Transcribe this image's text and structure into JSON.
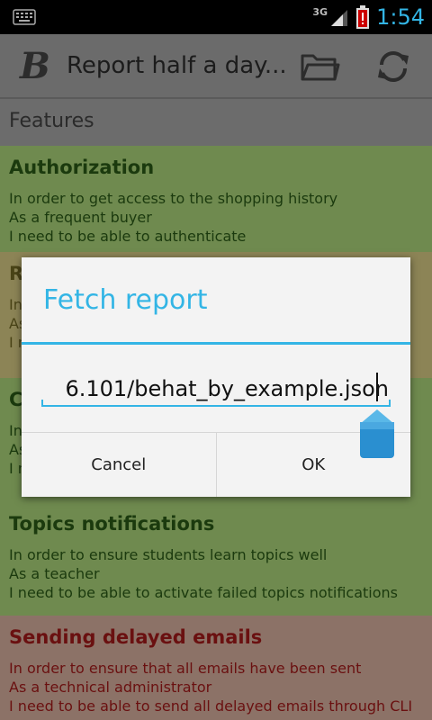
{
  "status_bar": {
    "network": "3G",
    "time": "1:54",
    "icons": [
      "keyboard-icon",
      "signal-icon",
      "battery-alert-icon"
    ]
  },
  "action_bar": {
    "title": "Report half a day...",
    "icons": [
      "app-logo-b",
      "folder-icon",
      "refresh-icon"
    ]
  },
  "content": {
    "section_header": "Features",
    "features": [
      {
        "title": "Authorization",
        "status": "passed",
        "lines": [
          "In order to get access to the shopping history",
          "As a frequent buyer",
          "I need to be able to authenticate"
        ]
      },
      {
        "title": "R",
        "status": "pending",
        "lines": [
          "In",
          "As",
          "I n"
        ]
      },
      {
        "title": "C",
        "status": "passed",
        "lines": [
          "In",
          "As",
          "I n"
        ]
      },
      {
        "title": "Topics notifications",
        "status": "passed",
        "lines": [
          "In order to ensure students learn topics well",
          "As a teacher",
          "I need to be able to activate failed topics notifications"
        ]
      },
      {
        "title": "Sending delayed emails",
        "status": "failed",
        "lines": [
          "In order to ensure that all emails have been sent",
          "As a technical administrator",
          "I need to be able to send all delayed emails through CLI"
        ]
      }
    ]
  },
  "dialog": {
    "title": "Fetch report",
    "input_value": "6.101/behat_by_example.json",
    "cancel_label": "Cancel",
    "ok_label": "OK"
  },
  "colors": {
    "accent": "#33b5e5",
    "passed_bg": "#6f8a4f",
    "pending_bg": "#8c8456",
    "failed_bg": "#8c7267"
  }
}
